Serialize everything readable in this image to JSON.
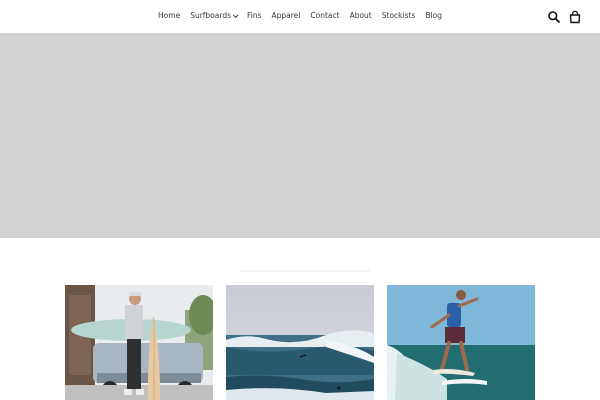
{
  "nav": {
    "items": [
      {
        "label": "Home"
      },
      {
        "label": "Surfboards",
        "has_dropdown": true
      },
      {
        "label": "Fins"
      },
      {
        "label": "Apparel"
      },
      {
        "label": "Contact"
      },
      {
        "label": "About"
      },
      {
        "label": "Stockists"
      },
      {
        "label": "Blog"
      }
    ]
  },
  "header_icons": [
    "search-icon",
    "cart-icon"
  ],
  "hero": {
    "color": "#d1d2d4"
  },
  "gallery": [
    {
      "name": "man-with-surfboards-photo"
    },
    {
      "name": "ocean-waves-photo"
    },
    {
      "name": "surfer-riding-wave-photo"
    }
  ]
}
